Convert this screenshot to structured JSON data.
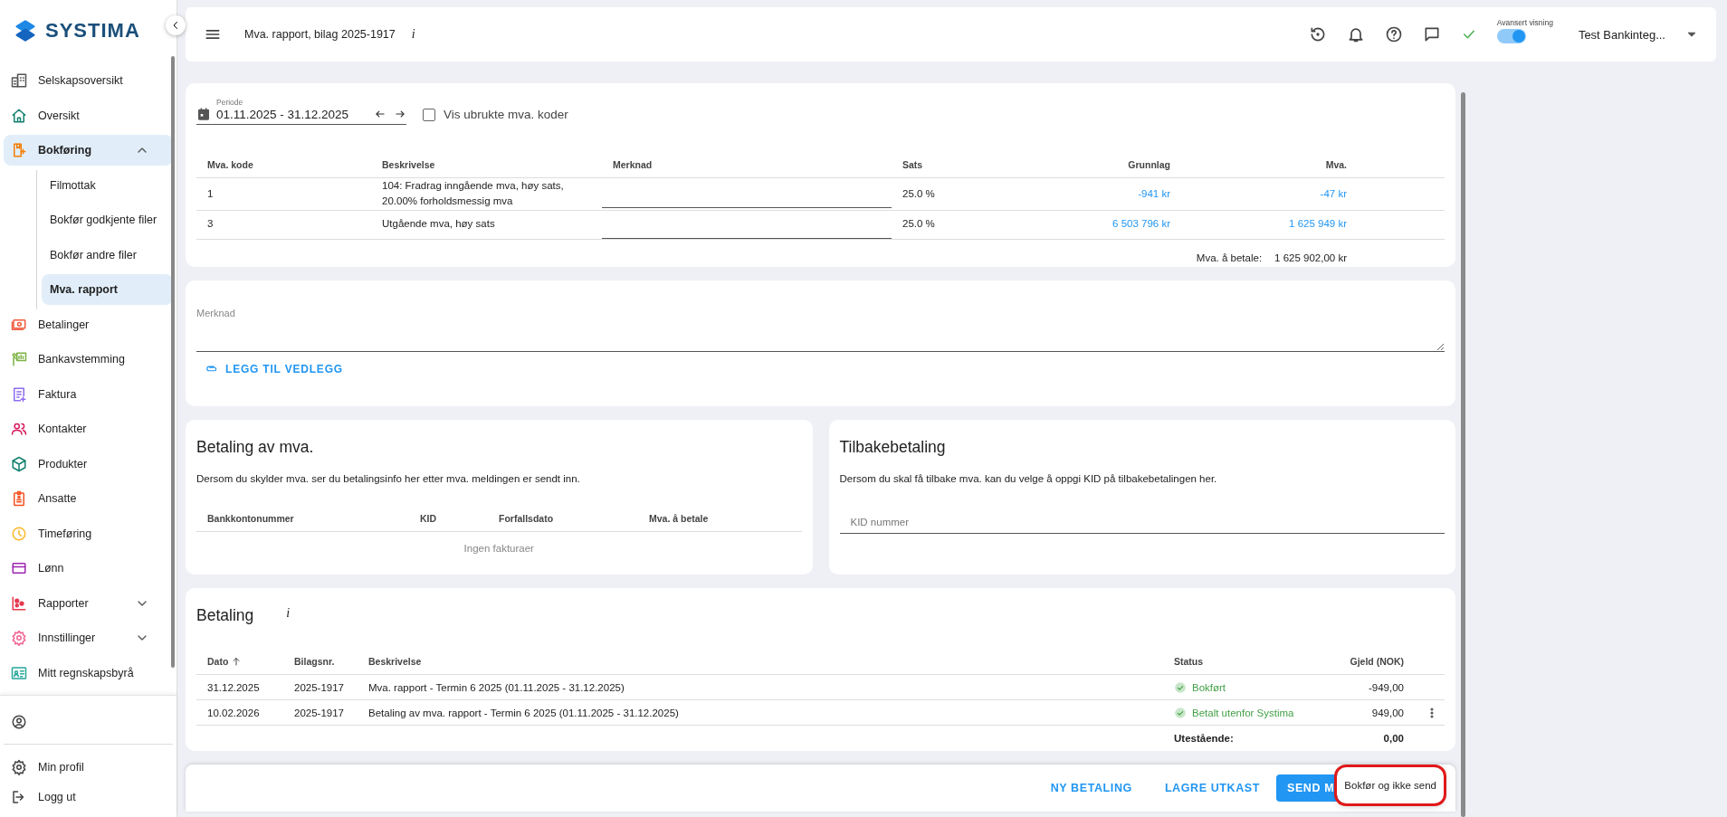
{
  "sidebar": {
    "logo": "SYSTIMA",
    "items": [
      {
        "label": "Selskapsoversikt",
        "kind": "link",
        "selected": false
      },
      {
        "label": "Oversikt",
        "kind": "link",
        "selected": false
      },
      {
        "label": "Bokføring",
        "kind": "group",
        "selected": true,
        "expanded": true,
        "children": [
          {
            "label": "Filmottak",
            "selected": false
          },
          {
            "label": "Bokfør godkjente filer",
            "selected": false
          },
          {
            "label": "Bokfør andre filer",
            "selected": false
          },
          {
            "label": "Mva. rapport",
            "selected": true
          }
        ]
      },
      {
        "label": "Betalinger",
        "kind": "link",
        "selected": false
      },
      {
        "label": "Bankavstemming",
        "kind": "link",
        "selected": false
      },
      {
        "label": "Faktura",
        "kind": "link",
        "selected": false
      },
      {
        "label": "Kontakter",
        "kind": "link",
        "selected": false
      },
      {
        "label": "Produkter",
        "kind": "link",
        "selected": false
      },
      {
        "label": "Ansatte",
        "kind": "link",
        "selected": false
      },
      {
        "label": "Timeføring",
        "kind": "link",
        "selected": false
      },
      {
        "label": "Lønn",
        "kind": "link",
        "selected": false
      },
      {
        "label": "Rapporter",
        "kind": "group",
        "selected": false,
        "expanded": false
      },
      {
        "label": "Innstillinger",
        "kind": "group",
        "selected": false,
        "expanded": false
      },
      {
        "label": "Mitt regnskapsbyrå",
        "kind": "link",
        "selected": false
      }
    ],
    "footer": [
      {
        "label": "Min profil"
      },
      {
        "label": "Logg ut"
      }
    ]
  },
  "top_bar": {
    "title": "Mva. rapport, bilag 2025-1917",
    "info": "i",
    "toggle": {
      "label": "Avansert visning",
      "on": true
    },
    "user": "Test Bankinteg..."
  },
  "report": {
    "period": {
      "label": "Periode",
      "value": "01.11.2025 - 31.12.2025"
    },
    "unused_codes": {
      "label": "Vis ubrukte mva. koder",
      "checked": false
    },
    "columns": [
      "Mva. kode",
      "Beskrivelse",
      "Merknad",
      "Sats",
      "Grunnlag",
      "Mva."
    ],
    "rows": [
      {
        "code": "1",
        "description": "104: Fradrag inngående mva, høy sats, 20.00% forholdsmessig mva",
        "rate": "25.0 %",
        "basis": "-941 kr",
        "vat": "-47 kr"
      },
      {
        "code": "3",
        "description": "Utgående mva, høy sats",
        "rate": "25.0 %",
        "basis": "6 503 796 kr",
        "vat": "1 625 949 kr"
      }
    ],
    "total_label": "Mva. å betale:",
    "total_value": "1 625 902,00 kr"
  },
  "note": {
    "placeholder": "Merknad",
    "attach": "LEGG TIL VEDLEGG"
  },
  "vat_payment": {
    "title": "Betaling av mva.",
    "text": "Dersom du skylder mva. ser du betalingsinfo her etter mva. meldingen er sendt inn.",
    "columns": [
      "Bankkontonummer",
      "KID",
      "Forfallsdato",
      "Mva. å betale"
    ],
    "empty": "Ingen fakturaer"
  },
  "refund": {
    "title": "Tilbakebetaling",
    "text": "Dersom du skal få tilbake mva. kan du velge å oppgi KID på tilbakebetalingen her.",
    "placeholder": "KID nummer"
  },
  "payments": {
    "title": "Betaling",
    "info": "i",
    "columns": [
      {
        "label": "Dato",
        "sorted": true
      },
      {
        "label": "Bilagsnr.",
        "sorted": false
      },
      {
        "label": "Beskrivelse",
        "sorted": false
      },
      {
        "label": "Status",
        "sorted": false
      },
      {
        "label": "Gjeld (NOK)",
        "sorted": false
      }
    ],
    "rows": [
      {
        "date": "31.12.2025",
        "voucher": "2025-1917",
        "description": "Mva. rapport - Termin 6 2025 (01.11.2025 - 31.12.2025)",
        "status": "Bokført",
        "amount": "-949,00",
        "menu": false
      },
      {
        "date": "10.02.2026",
        "voucher": "2025-1917",
        "description": "Betaling av mva. rapport - Termin 6 2025 (01.11.2025 - 31.12.2025)",
        "status": "Betalt utenfor Systima",
        "amount": "949,00",
        "menu": true
      }
    ],
    "total_label": "Utestående:",
    "total_value": "0,00"
  },
  "actions": {
    "buttons": [
      {
        "label": "NY BETALING",
        "kind": "text"
      },
      {
        "label": "LAGRE UTKAST",
        "kind": "text"
      },
      {
        "label": "SEND M",
        "kind": "primary"
      }
    ],
    "menu": [
      {
        "label": "Bokfør og ikke send",
        "highlighted": true
      }
    ]
  }
}
